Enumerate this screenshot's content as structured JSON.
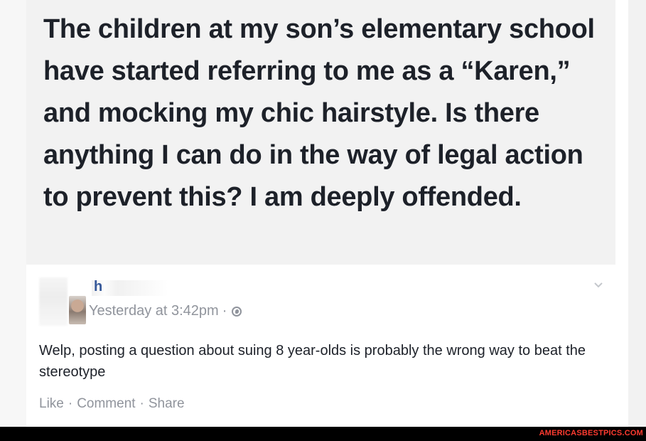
{
  "quote": {
    "text": "The children at my son’s elementary school have started referring to me as a “Karen,” and mocking my chic hairstyle. Is there anything I can do in the way of legal action to prevent this? I am deeply offended."
  },
  "comment": {
    "author_visible_fragment": "h",
    "timestamp": "Yesterday at 3:42pm",
    "separator": "·",
    "privacy_icon": "globe-icon",
    "menu_icon": "chevron-down-icon",
    "body": "Welp, posting a question about suing 8 year-olds is probably the wrong way to beat the stereotype",
    "actions": {
      "like": "Like",
      "comment": "Comment",
      "share": "Share",
      "separator": "·"
    }
  },
  "footer": {
    "watermark": "AMERICASBESTPICS.COM"
  },
  "colors": {
    "quote_background": "#f2f2f2",
    "text_primary": "#1d2129",
    "text_secondary": "#90949c",
    "author_link": "#365899",
    "watermark": "#ff3b30",
    "footer_bar": "#000000"
  }
}
